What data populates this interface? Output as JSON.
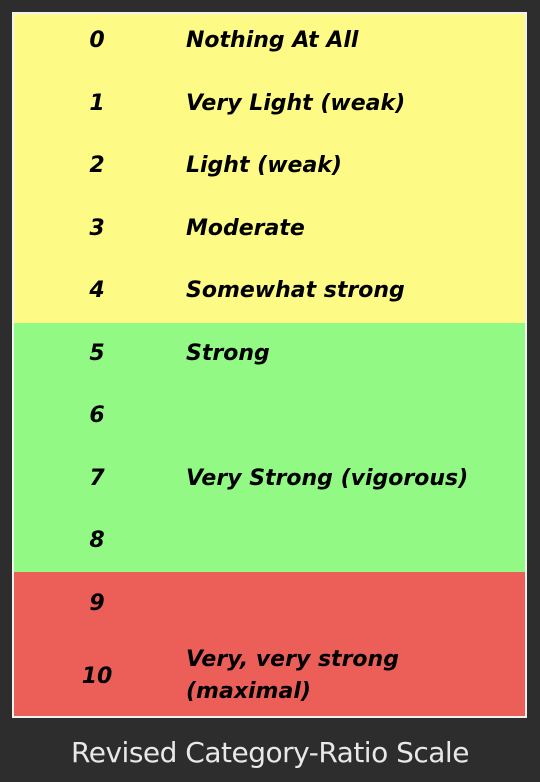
{
  "colors": {
    "yellow_band": "#fdfa85",
    "green_band": "#92f984",
    "red_band": "#ec5f59",
    "background": "#2d2d2d"
  },
  "rows": [
    {
      "num": "0",
      "desc": "Nothing At All"
    },
    {
      "num": "1",
      "desc": "Very Light (weak)"
    },
    {
      "num": "2",
      "desc": "Light (weak)"
    },
    {
      "num": "3",
      "desc": "Moderate"
    },
    {
      "num": "4",
      "desc": "Somewhat strong"
    },
    {
      "num": "5",
      "desc": "Strong"
    },
    {
      "num": "6",
      "desc": ""
    },
    {
      "num": "7",
      "desc": "Very Strong (vigorous)"
    },
    {
      "num": "8",
      "desc": ""
    },
    {
      "num": "9",
      "desc": ""
    },
    {
      "num": "10",
      "desc_line1": "Very, very strong",
      "desc_line2": "(maximal)"
    }
  ],
  "caption": "Revised Category-Ratio Scale"
}
